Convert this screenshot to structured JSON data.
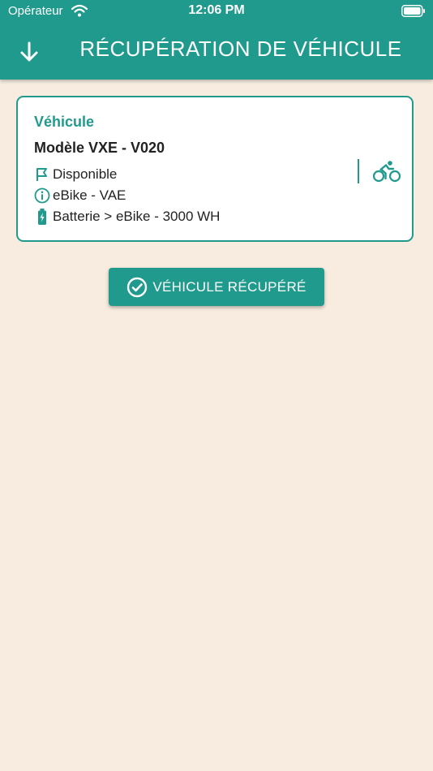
{
  "status_bar": {
    "carrier": "Opérateur",
    "time": "12:06 PM"
  },
  "header": {
    "title": "RÉCUPÉRATION DE VÉHICULE",
    "back_icon": "arrow-down-icon"
  },
  "card": {
    "section_label": "Véhicule",
    "vehicle_name": "Modèle VXE - V020",
    "status": "Disponible",
    "type": "eBike - VAE",
    "battery": "Batterie > eBike - 3000 WH",
    "type_icon": "bicycle-icon"
  },
  "confirm_button": {
    "label": "VÉHICULE RÉCUPÉRÉ",
    "icon": "check-circle-icon"
  },
  "colors": {
    "primary": "#1f9a8c",
    "background": "#f7ecdf",
    "card": "#ffffff",
    "text": "#222222"
  }
}
